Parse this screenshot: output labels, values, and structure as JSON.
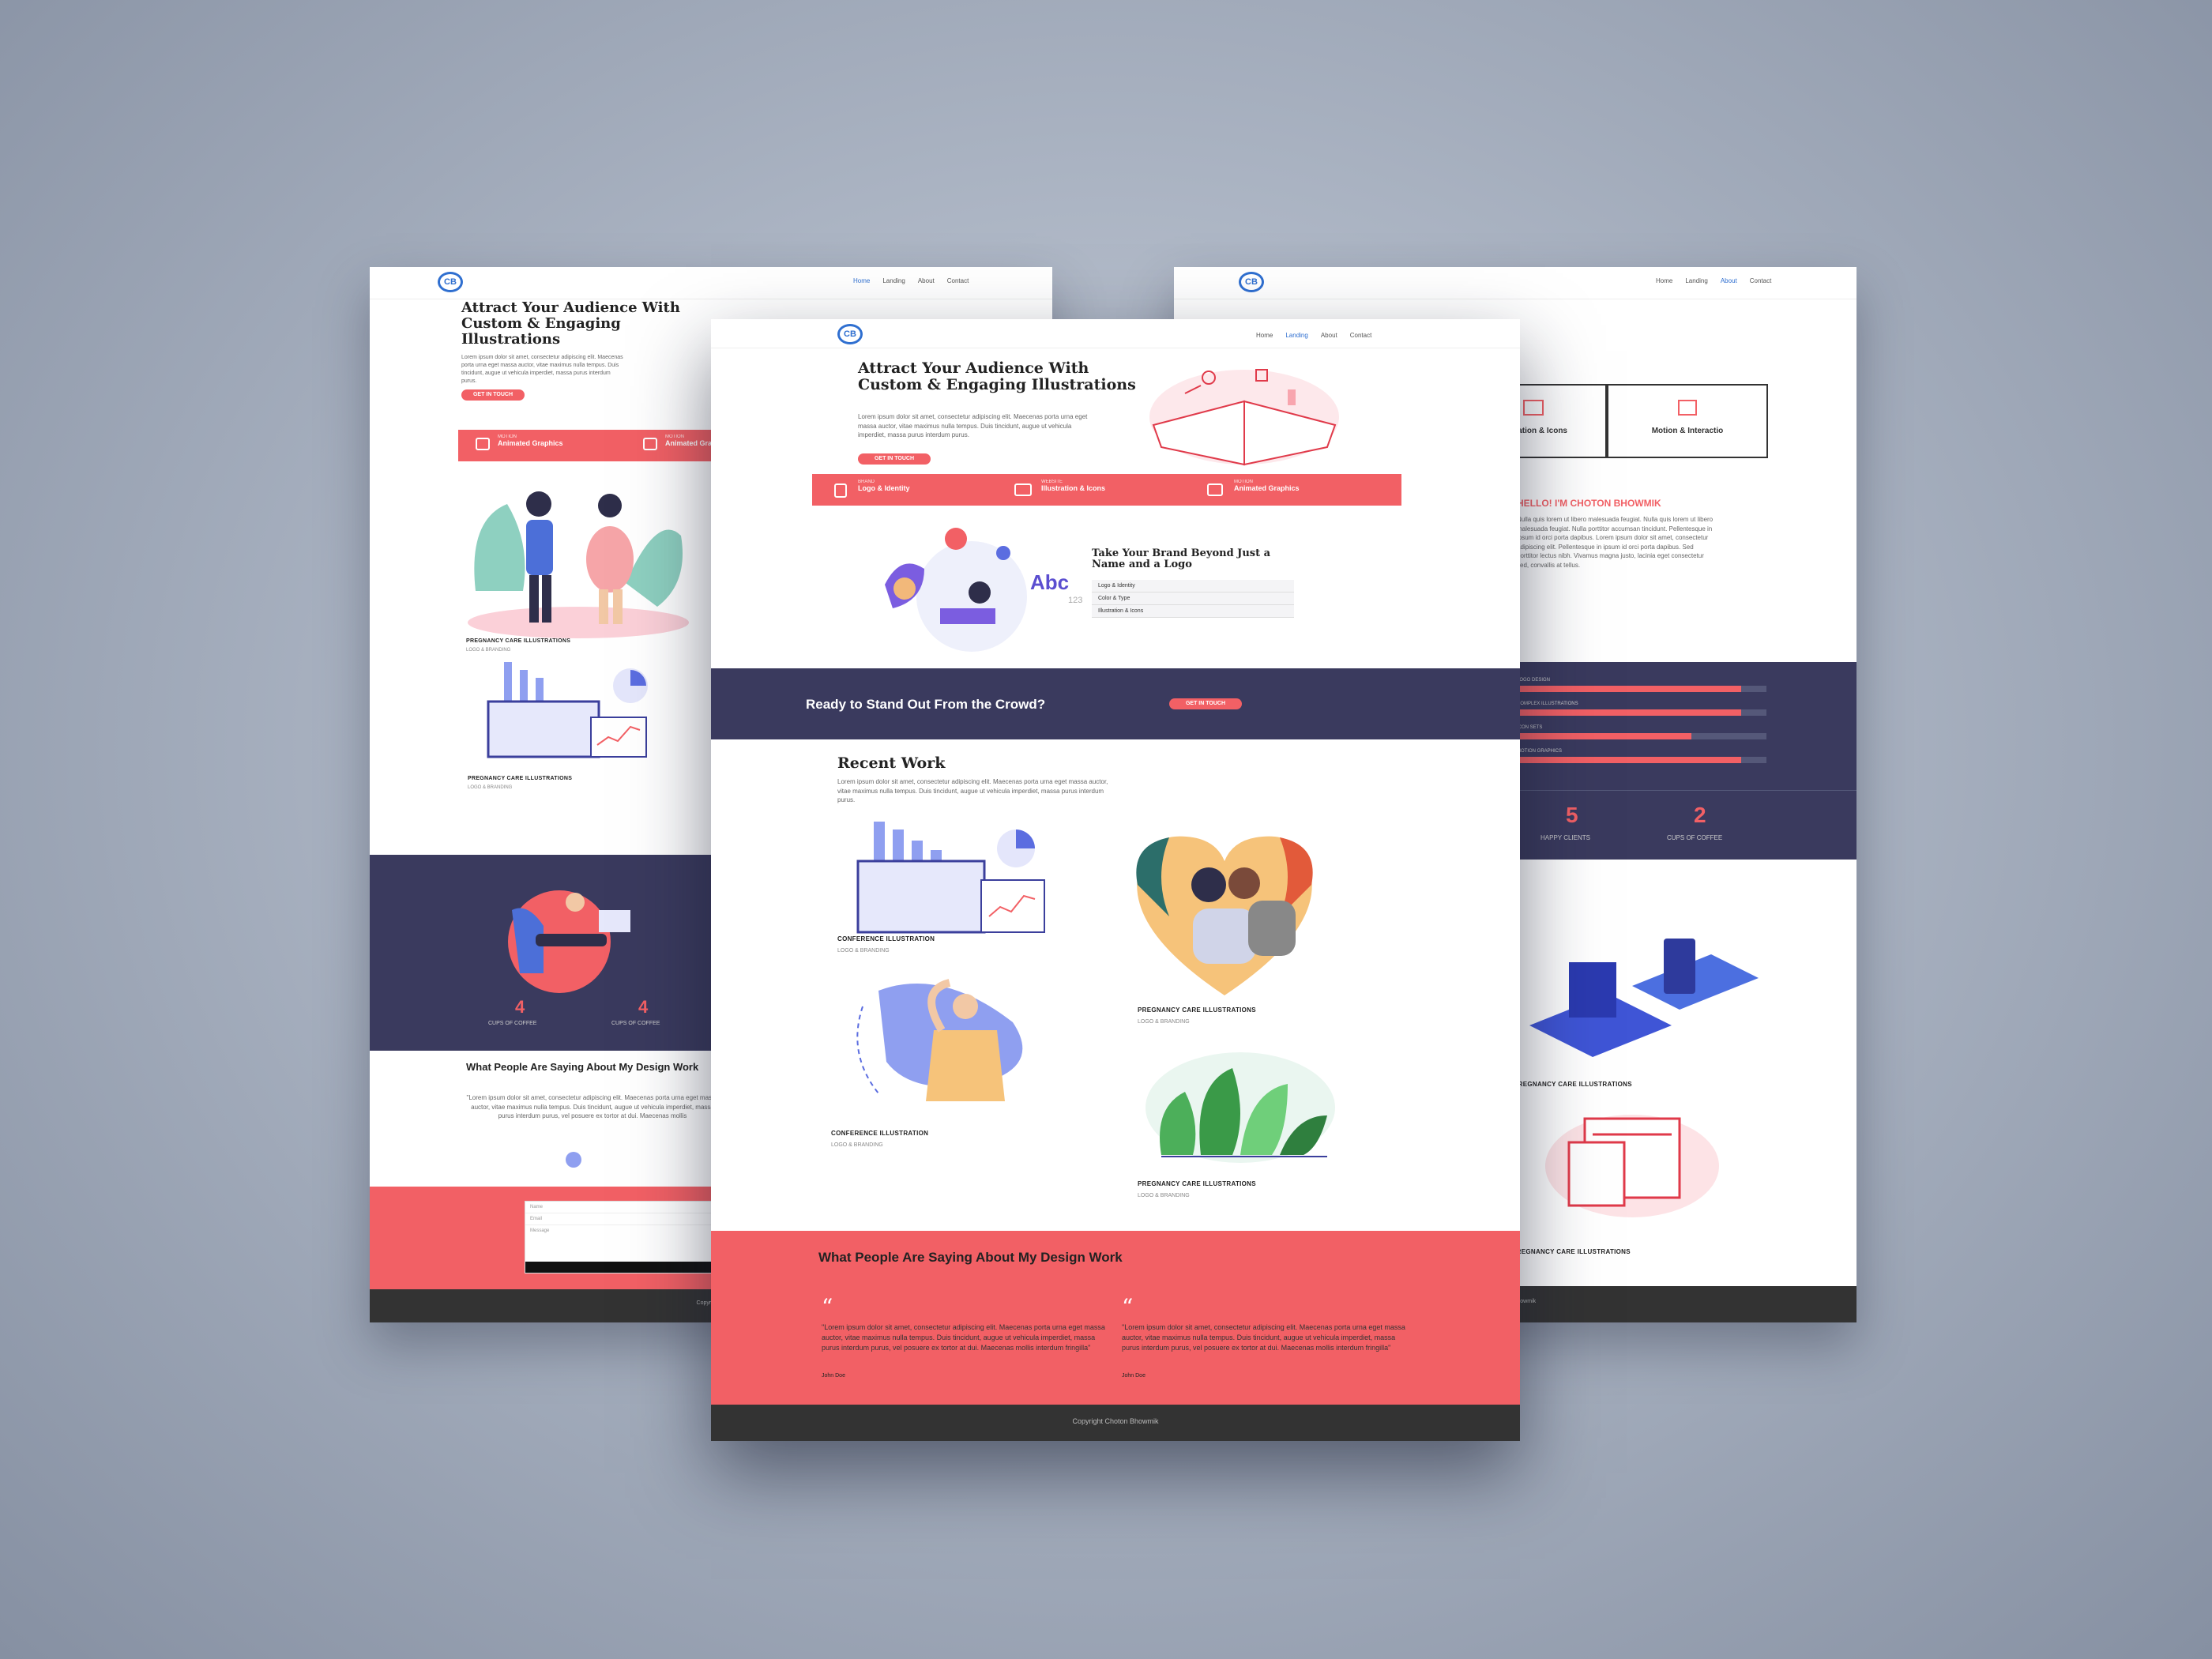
{
  "nav": {
    "logo": "CB",
    "links": [
      "Home",
      "Landing",
      "About",
      "Contact"
    ]
  },
  "hero": {
    "title": "Attract Your Audience With Custom & Engaging Illustrations",
    "text": "Lorem ipsum dolor sit amet, consectetur adipiscing elit. Maecenas porta urna eget massa auctor, vitae maximus nulla tempus. Duis tincidunt, augue ut vehicula imperdiet, massa purus interdum purus.",
    "cta": "GET IN TOUCH"
  },
  "services": [
    {
      "sub": "BRAND",
      "label": "Logo & Identity"
    },
    {
      "sub": "WEBSITE",
      "label": "Illustration & Icons"
    },
    {
      "sub": "MOTION",
      "label": "Animated Graphics"
    }
  ],
  "left_services": [
    {
      "sub": "MOTION",
      "label": "Animated Graphics"
    },
    {
      "sub": "MOTION",
      "label": "Animated Graphics"
    }
  ],
  "brand": {
    "title": "Take Your Brand Beyond Just a Name and a Logo",
    "items": [
      "Logo & Identity",
      "Color & Type",
      "Illustration & Icons"
    ],
    "abc": "Abc",
    "num": "123"
  },
  "cta_band": {
    "text": "Ready to Stand Out From the Crowd?",
    "button": "GET IN TOUCH"
  },
  "recent": {
    "title": "Recent Work",
    "text": "Lorem ipsum dolor sit amet, consectetur adipiscing elit. Maecenas porta urna eget massa auctor, vitae maximus nulla tempus. Duis tincidunt, augue ut vehicula imperdiet, massa purus interdum purus.",
    "works": [
      {
        "title": "CONFERENCE ILLUSTRATION",
        "sub": "LOGO & BRANDING"
      },
      {
        "title": "PREGNANCY CARE ILLUSTRATIONS",
        "sub": "LOGO & BRANDING"
      },
      {
        "title": "CONFERENCE ILLUSTRATION",
        "sub": "LOGO & BRANDING"
      },
      {
        "title": "PREGNANCY CARE ILLUSTRATIONS",
        "sub": "LOGO & BRANDING"
      }
    ]
  },
  "testimonials": {
    "title": "What People Are Saying About My Design Work",
    "quotes": [
      {
        "text": "\"Lorem ipsum dolor sit amet, consectetur adipiscing elit. Maecenas porta urna eget massa auctor, vitae maximus nulla tempus. Duis tincidunt, augue ut vehicula imperdiet, massa purus interdum purus, vel posuere ex tortor at dui. Maecenas mollis interdum fringilla\"",
        "author": "John Doe"
      },
      {
        "text": "\"Lorem ipsum dolor sit amet, consectetur adipiscing elit. Maecenas porta urna eget massa auctor, vitae maximus nulla tempus. Duis tincidunt, augue ut vehicula imperdiet, massa purus interdum purus, vel posuere ex tortor at dui. Maecenas mollis interdum fringilla\"",
        "author": "John Doe"
      }
    ]
  },
  "footer": {
    "copyright": "Copyright Choton Bhowmik"
  },
  "left_page": {
    "works": [
      {
        "title": "PREGNANCY CARE ILLUSTRATIONS",
        "sub": "LOGO & BRANDING"
      },
      {
        "title": "PREGNANCY CARE ILLUSTRATIONS",
        "sub": "LOGO & BRANDING"
      }
    ],
    "stats": [
      {
        "num": "4",
        "label": "CUPS OF COFFEE"
      },
      {
        "num": "4",
        "label": "CUPS OF COFFEE"
      }
    ],
    "testimonial_title": "What People Are Saying About My Design Work",
    "testimonial_text": "\"Lorem ipsum dolor sit amet, consectetur adipiscing elit. Maecenas porta urna eget massa auctor, vitae maximus nulla tempus. Duis tincidunt, augue ut vehicula imperdiet, massa purus interdum purus, vel posuere ex tortor at dui. Maecenas mollis",
    "form": {
      "name": "Name",
      "email": "Email",
      "message": "Message",
      "submit": "Se"
    },
    "copyright": "Copyright C"
  },
  "right_page": {
    "cards": [
      "Illustration & Icons",
      "Motion & Interactio"
    ],
    "hello_title": "HELLO! I'M CHOTON BHOWMIK",
    "hello_text": "Nulla quis lorem ut libero malesuada feugiat. Nulla quis lorem ut libero malesuada feugiat. Nulla porttitor accumsan tincidunt. Pellentesque in ipsum id orci porta dapibus. Lorem ipsum dolor sit amet, consectetur adipiscing elit. Pellentesque in ipsum id orci porta dapibus. Sed porttitor lectus nibh. Vivamus magna justo, lacinia eget consectetur sed, convallis at tellus.",
    "skills": [
      {
        "label": "LOGO DESIGN",
        "pct": "90%",
        "value": 0.9
      },
      {
        "label": "COMPLEX ILLUSTRATIONS",
        "pct": "90%",
        "value": 0.9
      },
      {
        "label": "ICON SETS",
        "pct": "70%",
        "value": 0.7
      },
      {
        "label": "MOTION GRAPHICS",
        "pct": "90%",
        "value": 0.9
      }
    ],
    "stats": [
      {
        "num": "5",
        "label": "HAPPY CLIENTS"
      },
      {
        "num": "2",
        "label": "CUPS OF COFFEE"
      }
    ],
    "works": [
      {
        "title": "PREGNANCY CARE ILLUSTRATIONS"
      },
      {
        "title": "PREGNANCY CARE ILLUSTRATIONS"
      }
    ],
    "footer": "on Bhowmik"
  }
}
